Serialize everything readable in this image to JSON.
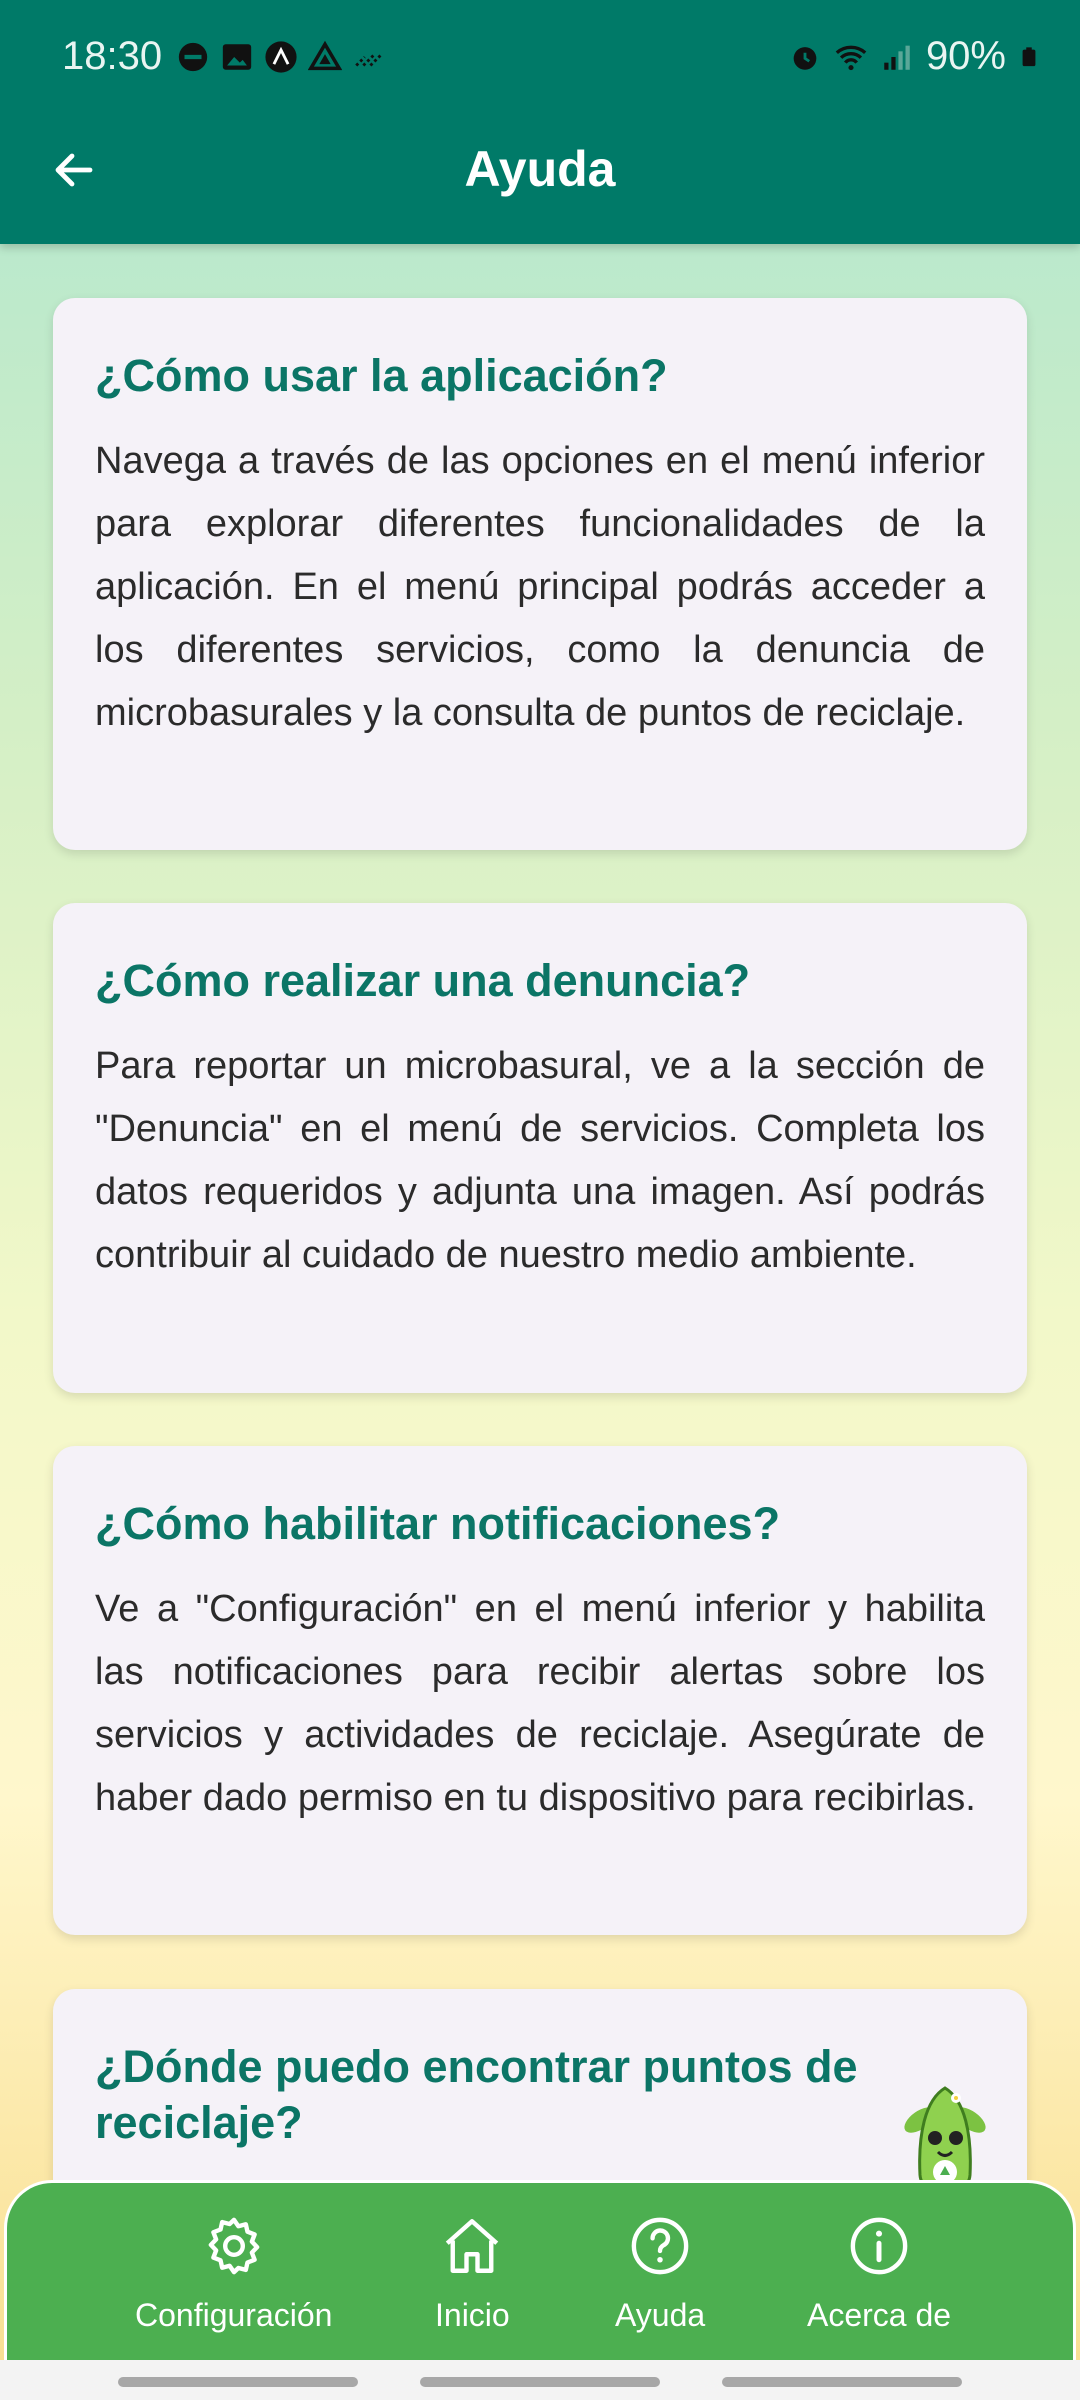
{
  "status_bar": {
    "time": "18:30",
    "battery": "90%",
    "icons": [
      "dnd-icon",
      "image-icon",
      "app-icon",
      "drive-icon",
      "signal-dots-icon",
      "alarm-icon",
      "wifi-icon",
      "cell-signal-icon",
      "battery-icon"
    ]
  },
  "app_bar": {
    "title": "Ayuda",
    "back_icon": "arrow-left-icon"
  },
  "cards": [
    {
      "title": "¿Cómo usar la aplicación?",
      "body": "Navega a través de las opciones en el menú inferior para explorar diferentes funcionalidades de la aplicación. En el menú principal podrás acceder a los diferentes servicios, como la denuncia de microbasurales y la consulta de puntos de reciclaje."
    },
    {
      "title": "¿Cómo realizar una denuncia?",
      "body": "Para reportar un microbasural, ve a la sección de \"Denuncia\" en el menú de servicios. Completa los datos requeridos y adjunta una imagen. Así podrás contribuir al cuidado de nuestro medio ambiente."
    },
    {
      "title": "¿Cómo habilitar notificaciones?",
      "body": "Ve a \"Configuración\" en el menú inferior y habilita las notificaciones para recibir alertas sobre los servicios y actividades de reciclaje. Asegúrate de haber dado permiso en tu dispositivo para recibirlas."
    },
    {
      "title": "¿Dónde puedo encontrar puntos de reciclaje?",
      "body": ""
    }
  ],
  "bottom_nav": [
    {
      "label": "Configuración",
      "icon": "gear-icon"
    },
    {
      "label": "Inicio",
      "icon": "home-icon"
    },
    {
      "label": "Ayuda",
      "icon": "help-circle-icon"
    },
    {
      "label": "Acerca de",
      "icon": "info-circle-icon"
    }
  ],
  "colors": {
    "app_bar": "#007a68",
    "title_text": "#0b7566",
    "bottom_nav": "#4caf50",
    "card_bg": "#f5f2f8"
  }
}
